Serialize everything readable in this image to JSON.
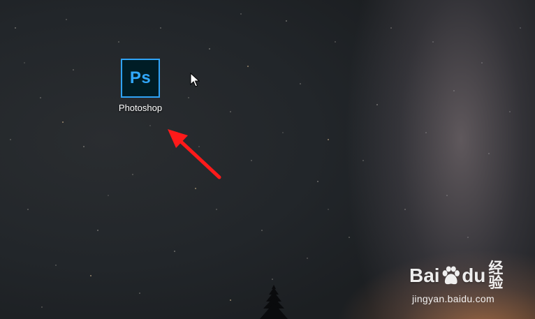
{
  "desktop": {
    "icons": [
      {
        "app_icon_text": "Ps",
        "label": "Photoshop",
        "icon_name": "photoshop-icon",
        "accent_color": "#31a8ff",
        "tile_color": "#001d26"
      }
    ]
  },
  "annotation": {
    "arrow_color": "#ff1a1a",
    "icon_name": "red-arrow-icon"
  },
  "watermark": {
    "brand_left": "Bai",
    "brand_right": "du",
    "brand_cn": "经验",
    "url": "jingyan.baidu.com",
    "icon_name": "baidu-paw-icon"
  }
}
